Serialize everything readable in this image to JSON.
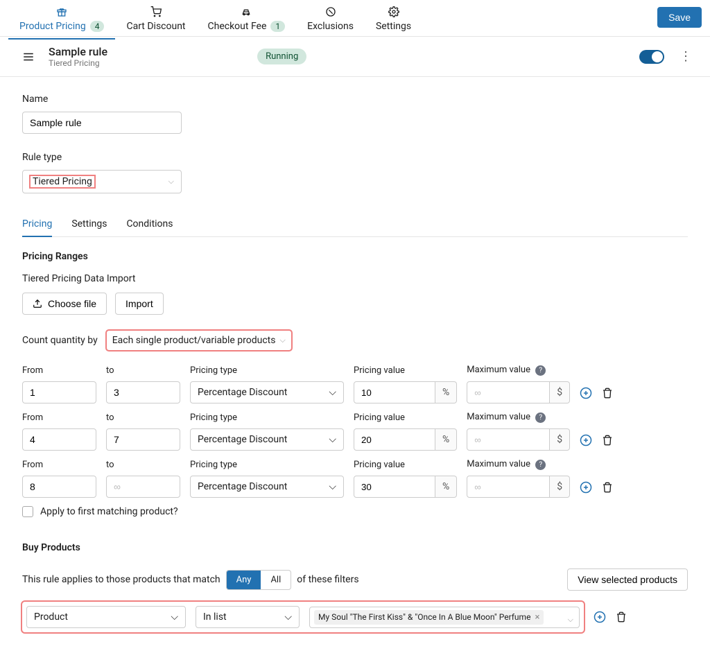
{
  "top_nav": {
    "items": [
      {
        "label": "Product Pricing",
        "badge": "4"
      },
      {
        "label": "Cart Discount"
      },
      {
        "label": "Checkout Fee",
        "badge": "1"
      },
      {
        "label": "Exclusions"
      },
      {
        "label": "Settings"
      }
    ],
    "save": "Save"
  },
  "header": {
    "title": "Sample rule",
    "subtitle": "Tiered Pricing",
    "status": "Running"
  },
  "form": {
    "name_label": "Name",
    "name_value": "Sample rule",
    "rule_type_label": "Rule type",
    "rule_type_value": "Tiered Pricing"
  },
  "sub_tabs": [
    "Pricing",
    "Settings",
    "Conditions"
  ],
  "pricing": {
    "section_title": "Pricing Ranges",
    "import_label": "Tiered Pricing Data Import",
    "choose_file": "Choose file",
    "import_btn": "Import",
    "count_label": "Count quantity by",
    "count_value": "Each single product/variable products",
    "cols": {
      "from": "From",
      "to": "to",
      "pricing_type": "Pricing type",
      "pricing_value": "Pricing value",
      "max_value": "Maximum value"
    },
    "ranges": [
      {
        "from": "1",
        "to": "3",
        "type": "Percentage Discount",
        "value": "10",
        "unit": "%",
        "max": "",
        "max_unit": "$"
      },
      {
        "from": "4",
        "to": "7",
        "type": "Percentage Discount",
        "value": "20",
        "unit": "%",
        "max": "",
        "max_unit": "$"
      },
      {
        "from": "8",
        "to": "",
        "type": "Percentage Discount",
        "value": "30",
        "unit": "%",
        "max": "",
        "max_unit": "$"
      }
    ],
    "infinity_placeholder": "∞",
    "apply_first": "Apply to first matching product?"
  },
  "buy": {
    "title": "Buy Products",
    "sentence_pre": "This rule applies to those products that match",
    "any": "Any",
    "all": "All",
    "sentence_post": "of these filters",
    "view_btn": "View selected products",
    "filter_type": "Product",
    "filter_op": "In list",
    "tag": "My Soul \"The First Kiss\" & \"Once In A Blue Moon\" Perfume"
  }
}
